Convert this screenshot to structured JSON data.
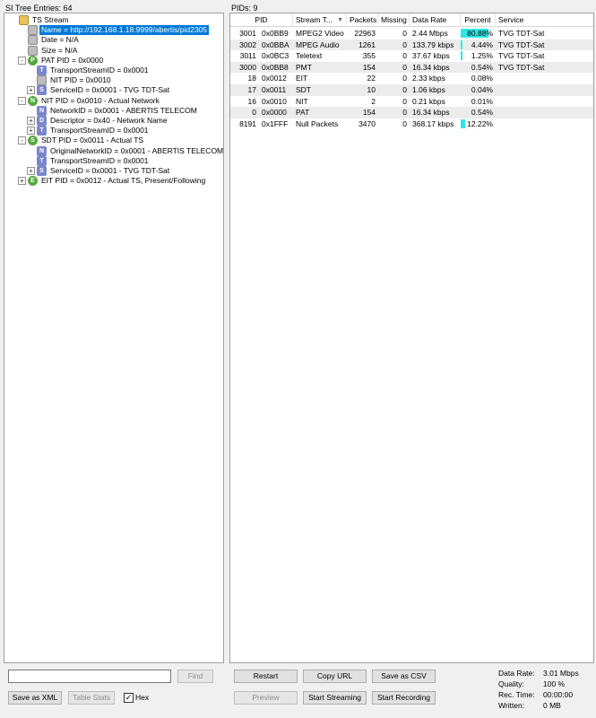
{
  "left_header": "SI Tree Entries: 64",
  "right_header": "PIDs: 9",
  "tree": [
    {
      "label": "TS Stream",
      "icon": "folder-icon"
    },
    {
      "label": "Name = http://192.168.1.18:9999/abertis/pid2305",
      "icon": "box-icon"
    },
    {
      "label": "Date = N/A",
      "icon": "box-icon"
    },
    {
      "label": "Size = N/A",
      "icon": "box-icon"
    },
    {
      "label": "PAT PID = 0x0000",
      "icon": "P",
      "expander": "-"
    },
    {
      "label": "TransportStreamID = 0x0001",
      "icon": "T"
    },
    {
      "label": "NIT PID = 0x0010",
      "icon": "box-icon"
    },
    {
      "label": "ServiceID = 0x0001 - TVG TDT-Sat",
      "icon": "S",
      "expander": "+"
    },
    {
      "label": "NIT PID = 0x0010 - Actual Network",
      "icon": "N",
      "expander": "-"
    },
    {
      "label": "NetworkID = 0x0001 - ABERTIS TELECOM",
      "icon": "N"
    },
    {
      "label": "Descriptor = 0x40 - Network Name",
      "icon": "D",
      "expander": "+"
    },
    {
      "label": "TransportStreamID = 0x0001",
      "icon": "T",
      "expander": "+"
    },
    {
      "label": "SDT PID = 0x0011 - Actual TS",
      "icon": "S",
      "expander": "-"
    },
    {
      "label": "OriginalNetworkID = 0x0001 - ABERTIS TELECOM",
      "icon": "N"
    },
    {
      "label": "TransportStreamID = 0x0001",
      "icon": "T"
    },
    {
      "label": "ServiceID = 0x0001 - TVG TDT-Sat",
      "icon": "S",
      "expander": "+"
    },
    {
      "label": "EIT PID = 0x0012 - Actual TS, Present/Following",
      "icon": "E",
      "expander": "+"
    }
  ],
  "table": {
    "columns": [
      "PID",
      "Stream T...",
      "Packets",
      "Missing",
      "Data Rate",
      "Percent",
      "Service"
    ],
    "rows": [
      {
        "pid": "3001",
        "hex": "0x0BB9",
        "type": "MPEG2 Video",
        "packets": "22963",
        "missing": "0",
        "rate": "2.44 Mbps",
        "percent": "80.88%",
        "pct_value": 80.88,
        "service": "TVG TDT-Sat"
      },
      {
        "pid": "3002",
        "hex": "0x0BBA",
        "type": "MPEG Audio",
        "packets": "1261",
        "missing": "0",
        "rate": "133.79 kbps",
        "percent": "4.44%",
        "pct_value": 4.44,
        "service": "TVG TDT-Sat"
      },
      {
        "pid": "3011",
        "hex": "0x0BC3",
        "type": "Teletext",
        "packets": "355",
        "missing": "0",
        "rate": "37.67 kbps",
        "percent": "1.25%",
        "pct_value": 1.25,
        "service": "TVG TDT-Sat"
      },
      {
        "pid": "3000",
        "hex": "0x0BB8",
        "type": "PMT",
        "packets": "154",
        "missing": "0",
        "rate": "16.34 kbps",
        "percent": "0.54%",
        "pct_value": 0.54,
        "service": "TVG TDT-Sat"
      },
      {
        "pid": "18",
        "hex": "0x0012",
        "type": "EIT",
        "packets": "22",
        "missing": "0",
        "rate": "2.33 kbps",
        "percent": "0.08%",
        "pct_value": 0.08,
        "service": ""
      },
      {
        "pid": "17",
        "hex": "0x0011",
        "type": "SDT",
        "packets": "10",
        "missing": "0",
        "rate": "1.06 kbps",
        "percent": "0.04%",
        "pct_value": 0.04,
        "service": ""
      },
      {
        "pid": "16",
        "hex": "0x0010",
        "type": "NIT",
        "packets": "2",
        "missing": "0",
        "rate": "0.21 kbps",
        "percent": "0.01%",
        "pct_value": 0.01,
        "service": ""
      },
      {
        "pid": "0",
        "hex": "0x0000",
        "type": "PAT",
        "packets": "154",
        "missing": "0",
        "rate": "16.34 kbps",
        "percent": "0.54%",
        "pct_value": 0.54,
        "service": ""
      },
      {
        "pid": "8191",
        "hex": "0x1FFF",
        "type": "Null Packets",
        "packets": "3470",
        "missing": "0",
        "rate": "368.17 kbps",
        "percent": "12.22%",
        "pct_value": 12.22,
        "service": ""
      }
    ]
  },
  "left_controls": {
    "find_value": "",
    "find_label": "Find",
    "save_xml": "Save as XML",
    "table_stats": "Table Stats",
    "hex_label": "Hex",
    "hex_checked": true
  },
  "right_controls": {
    "restart": "Restart",
    "copy_url": "Copy URL",
    "save_csv": "Save as CSV",
    "preview": "Preview",
    "start_streaming": "Start Streaming",
    "start_recording": "Start Recording"
  },
  "stats": {
    "data_rate_label": "Data Rate:",
    "data_rate": "3.01 Mbps",
    "quality_label": "Quality:",
    "quality": "100 %",
    "rec_time_label": "Rec. Time:",
    "rec_time": "00:00:00",
    "written_label": "Written:",
    "written": "0 MB"
  },
  "colors": {
    "selection": "#0078d7",
    "percent_bar": "#2ee8e8",
    "node_green": "#54a83c"
  }
}
